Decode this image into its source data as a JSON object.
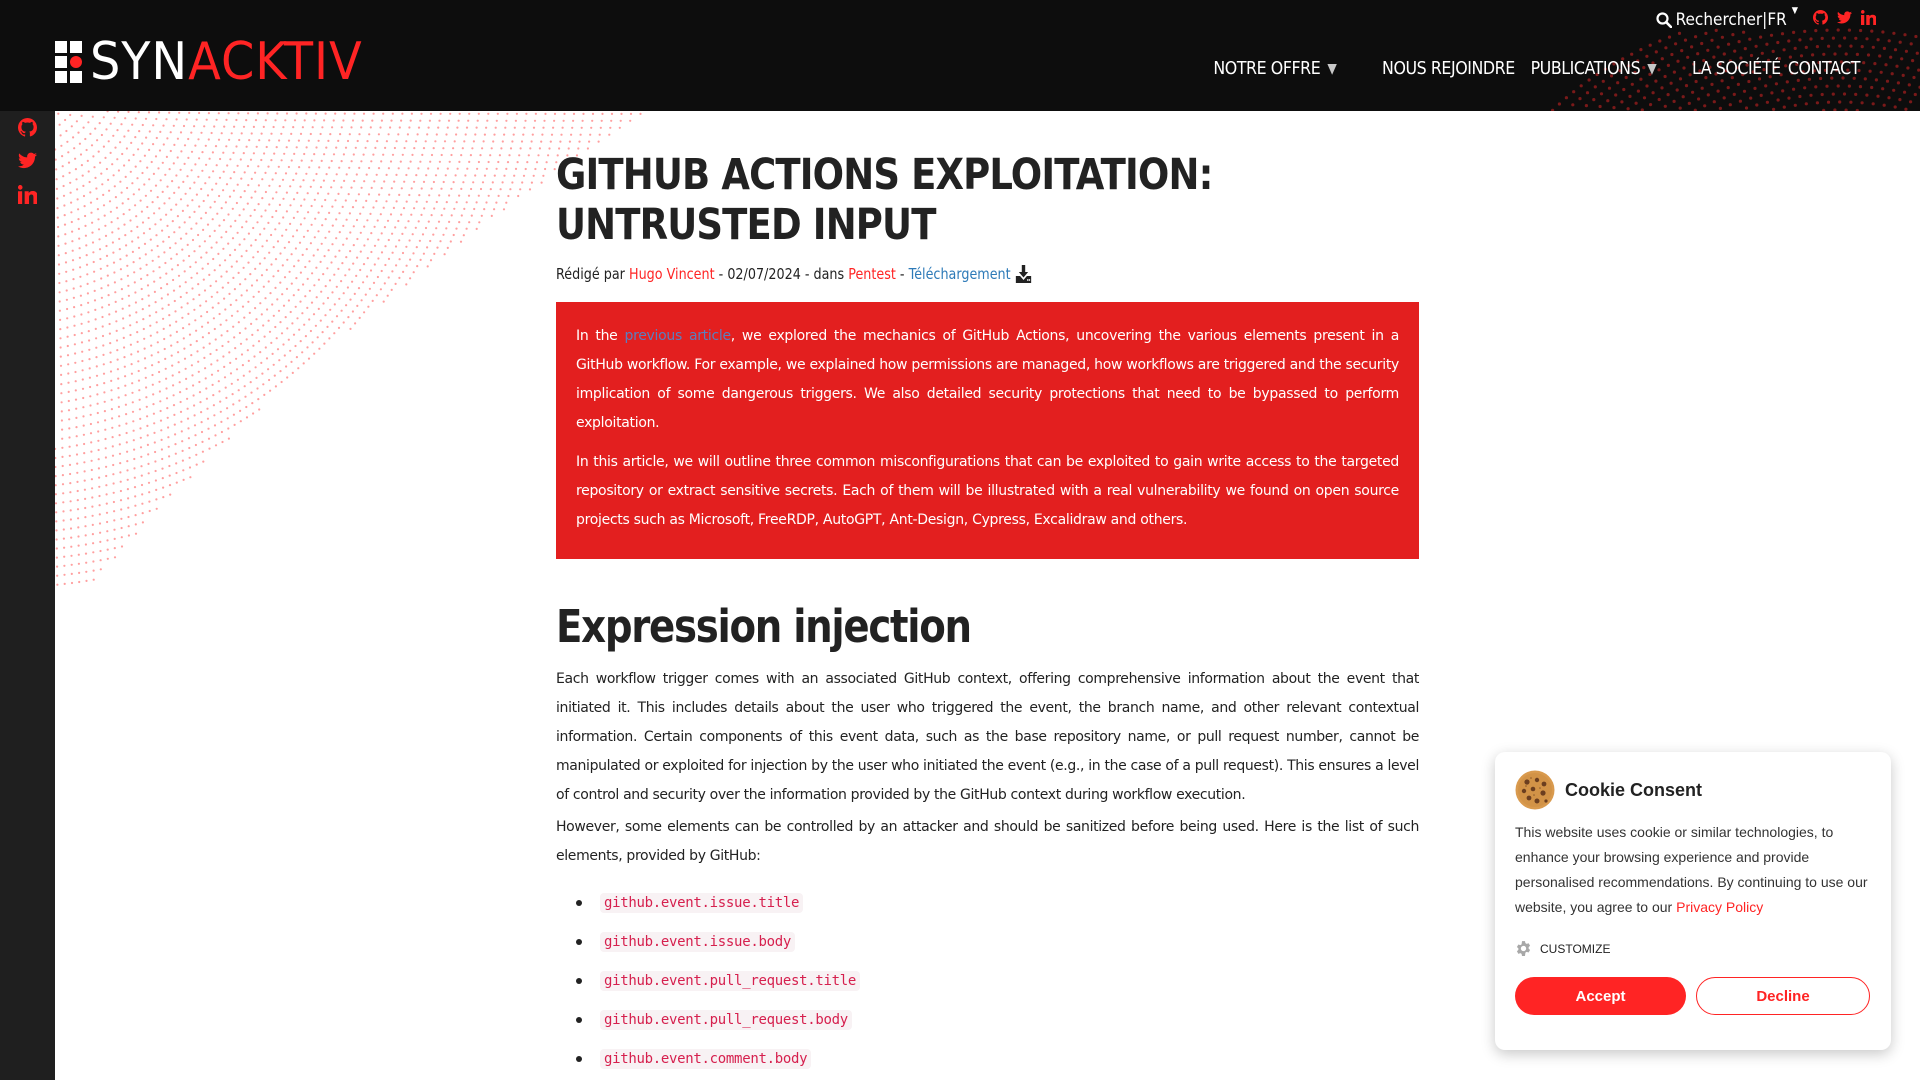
{
  "header": {
    "logo": {
      "part1": "SYN",
      "part2": "ACKTIV"
    },
    "topbar": {
      "search_label": "Rechercher",
      "separator": "|",
      "language": "FR",
      "social": [
        "github-icon",
        "twitter-icon",
        "linkedin-icon"
      ]
    },
    "nav": [
      {
        "label": "NOTRE OFFRE",
        "dropdown": true
      },
      {
        "label": "NOUS REJOINDRE",
        "dropdown": false
      },
      {
        "label": "PUBLICATIONS",
        "dropdown": true
      },
      {
        "label": "LA SOCIÉTÉ",
        "dropdown": false
      },
      {
        "label": "CONTACT",
        "dropdown": false
      }
    ],
    "dropdown_glyph": "▼"
  },
  "sidebar": {
    "social": [
      "github-icon",
      "twitter-icon",
      "linkedin-icon"
    ]
  },
  "article": {
    "title": "GITHUB ACTIONS EXPLOITATION: UNTRUSTED INPUT",
    "meta": {
      "written_by": "Rédigé par",
      "author": "Hugo Vincent",
      "sep1": " - ",
      "date": "02/07/2024",
      "in_label": " - dans ",
      "category": "Pentest",
      "sep2": " - ",
      "download": "Téléchargement"
    },
    "intro": {
      "p1_before": "In the ",
      "p1_link": "previous article",
      "p1_after": ", we explored the mechanics of GitHub Actions, uncovering the various elements present in a GitHub workflow. For example, we explained how permissions are managed, how workflows are triggered and the security implication of some dangerous triggers. We also detailed security protections that need to be bypassed to perform exploitation.",
      "p2": "In this article, we will outline three common misconfigurations that can be exploited to gain write access to the targeted repository or extract sensitive secrets. Each of them will be illustrated with a real vulnerability we found on open source projects such as Microsoft, FreeRDP, AutoGPT, Ant-Design, Cypress, Excalidraw and others."
    },
    "section_title": "Expression injection",
    "paragraphs": [
      "Each workflow trigger comes with an associated GitHub context, offering comprehensive information about the event that initiated it. This includes details about the user who triggered the event, the branch name, and other relevant contextual information. Certain components of this event data, such as the base repository name, or pull request number, cannot be manipulated or exploited for injection by the user who initiated the event (e.g., in the case of a pull request). This ensures a level of control and security over the information provided by the GitHub context during workflow execution.",
      "However, some elements can be controlled by an attacker and should be sanitized before being used. Here is the list of such elements, provided by GitHub:"
    ],
    "code_items": [
      "github.event.issue.title",
      "github.event.issue.body",
      "github.event.pull_request.title",
      "github.event.pull_request.body",
      "github.event.comment.body"
    ]
  },
  "cookie": {
    "title": "Cookie Consent",
    "text": "This website uses cookie or similar technologies, to enhance your browsing experience and provide personalised recommendations. By continuing to use our website, you agree to our ",
    "policy_link": "Privacy Policy",
    "customize": "CUSTOMIZE",
    "accept": "Accept",
    "decline": "Decline"
  },
  "colors": {
    "brand_red": "#ff2424",
    "intro_bg": "#e31f1f",
    "header_bg": "#0d0d0d",
    "sidebar_bg": "#1f1f1f",
    "link_blue": "#2d7ab8",
    "code_color": "#d6204e"
  }
}
